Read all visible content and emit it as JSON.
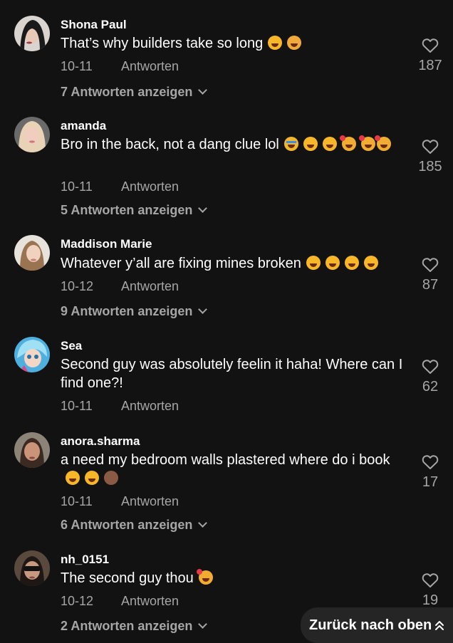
{
  "comments": [
    {
      "username": "Shona Paul",
      "text": "That’s why builders take so long",
      "emojis": [
        "rolling-laughing",
        "flushed-face"
      ],
      "date": "10-11",
      "reply_label": "Antworten",
      "likes": "187",
      "view_replies": "7 Antworten anzeigen"
    },
    {
      "username": "amanda",
      "text": "Bro in the back, not a dang clue lol",
      "emojis": [
        "loudly-crying",
        "grinning-sweat",
        "grinning-sweat",
        "smiling-hearts",
        "smiling-hearts",
        "smiling-hearts"
      ],
      "date": "10-11",
      "reply_label": "Antworten",
      "likes": "185",
      "view_replies": "5 Antworten anzeigen"
    },
    {
      "username": "Maddison Marie",
      "text": "Whatever y’all are fixing mines broken",
      "emojis": [
        "grinning-sweat",
        "grinning-sweat",
        "grinning-sweat",
        "grinning-sweat"
      ],
      "date": "10-12",
      "reply_label": "Antworten",
      "likes": "87",
      "view_replies": "9 Antworten anzeigen"
    },
    {
      "username": "Sea",
      "text": "Second guy was absolutely feelin it haha! Where can I find one?!",
      "emojis": [],
      "date": "10-11",
      "reply_label": "Antworten",
      "likes": "62",
      "view_replies": ""
    },
    {
      "username": "anora.sharma",
      "text": "a need my bedroom walls plastered where do i book",
      "emojis": [
        "rolling-laughing",
        "rolling-laughing",
        "see-no-evil-monkey"
      ],
      "date": "10-11",
      "reply_label": "Antworten",
      "likes": "17",
      "view_replies": "6 Antworten anzeigen"
    },
    {
      "username": "nh_0151",
      "text": "The second guy thou",
      "emojis": [
        "smiling-hearts"
      ],
      "date": "10-12",
      "reply_label": "Antworten",
      "likes": "19",
      "view_replies": "2 Antworten anzeigen"
    }
  ],
  "back_to_top": {
    "label": "Zurück nach oben",
    "icon": "double-chevron-up-icon"
  },
  "colors": {
    "background": "#121212",
    "secondary_text": "#a6a6a6",
    "primary_text": "#ffffff",
    "button_bg": "#252525"
  }
}
